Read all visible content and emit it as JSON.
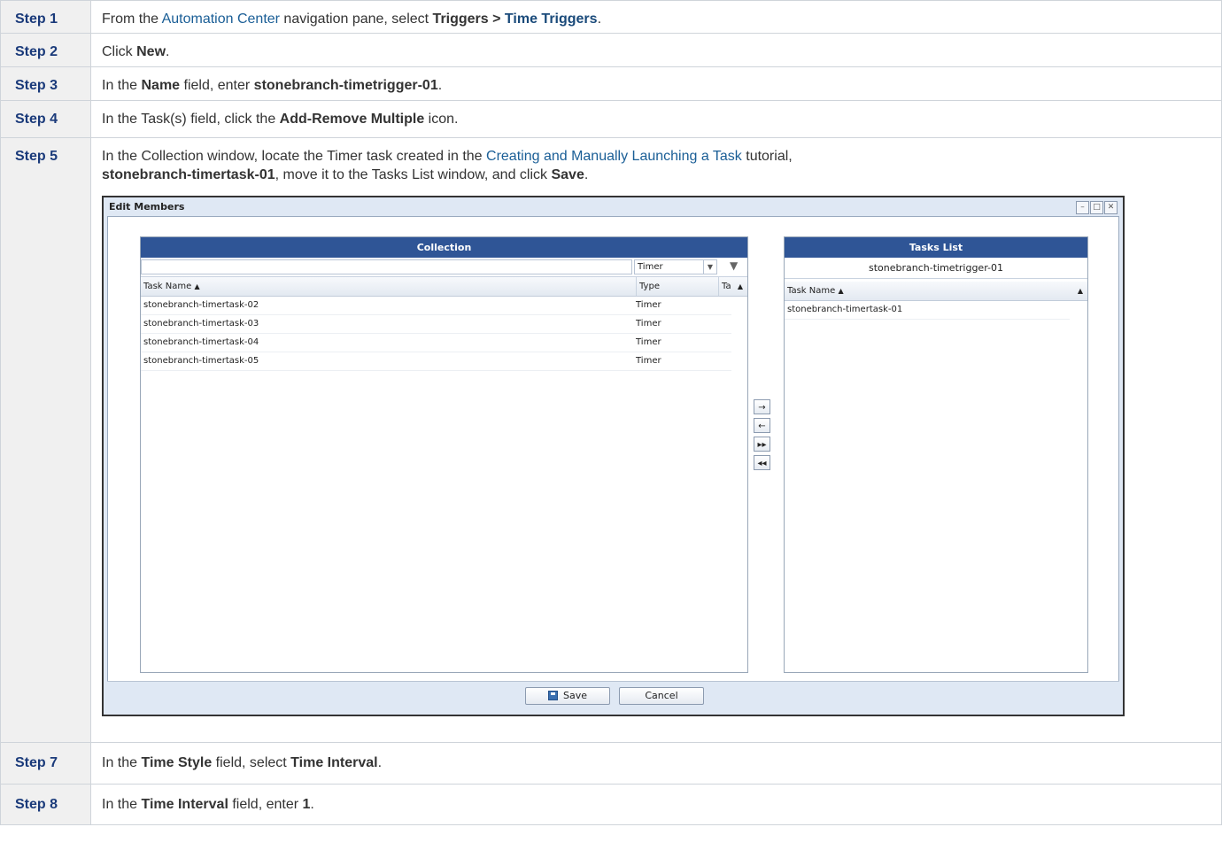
{
  "steps": [
    {
      "label": "Step 1",
      "t1": "From the ",
      "link": "Automation Center",
      "t2": " navigation pane, select ",
      "b1": "Triggers > ",
      "b2": "Time Triggers",
      "t3": "."
    },
    {
      "label": "Step 2",
      "t1": "Click ",
      "b1": "New",
      "t2": "."
    },
    {
      "label": "Step 3",
      "t1": "In the ",
      "b1": "Name",
      "t2": " field, enter ",
      "b2": "stonebranch-timetrigger-01",
      "t3": "."
    },
    {
      "label": "Step 4",
      "t1": "In the Task(s) field, click the ",
      "b1": "Add-Remove Multiple",
      "t2": " icon."
    },
    {
      "label": "Step 5",
      "t1": "In the Collection window, locate the Timer task created in the ",
      "link": "Creating and Manually Launching a Task",
      "t2": " tutorial,",
      "b1": "stonebranch-timertask-01",
      "t3": ", move it to the Tasks List window, and click ",
      "b2": "Save",
      "t4": "."
    },
    {
      "label": "Step 7",
      "t1": "In the ",
      "b1": "Time Style",
      "t2": " field, select ",
      "b2": "Time Interval",
      "t3": "."
    },
    {
      "label": "Step 8",
      "t1": "In the ",
      "b1": "Time Interval",
      "t2": " field, enter ",
      "b2": "1",
      "t3": "."
    }
  ],
  "dialog": {
    "title": "Edit Members",
    "collection": {
      "header": "Collection",
      "filter_value": "",
      "type_select": "Timer",
      "columns": [
        "Task Name",
        "Type",
        "Ta"
      ],
      "rows": [
        {
          "name": "stonebranch-timertask-02",
          "type": "Timer"
        },
        {
          "name": "stonebranch-timertask-03",
          "type": "Timer"
        },
        {
          "name": "stonebranch-timertask-04",
          "type": "Timer"
        },
        {
          "name": "stonebranch-timertask-05",
          "type": "Timer"
        }
      ]
    },
    "tasks_list": {
      "header": "Tasks List",
      "trigger_name": "stonebranch-timetrigger-01",
      "column": "Task Name",
      "rows": [
        {
          "name": "stonebranch-timertask-01"
        }
      ]
    },
    "move_buttons": [
      "→",
      "←",
      "▸▸",
      "◂◂"
    ],
    "save_label": "Save",
    "cancel_label": "Cancel"
  }
}
